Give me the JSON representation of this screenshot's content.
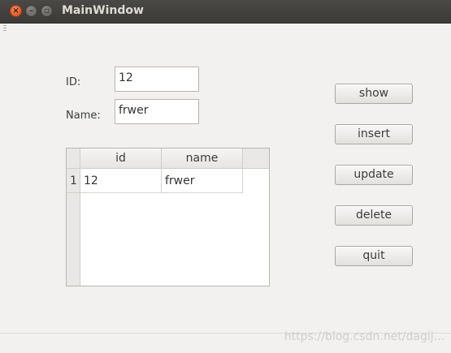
{
  "window": {
    "title": "MainWindow"
  },
  "titlebar": {
    "close_glyph": "×",
    "min_glyph": "–",
    "max_glyph": "▫"
  },
  "form": {
    "id_label": "ID:",
    "id_value": "12",
    "name_label": "Name:",
    "name_value": "frwer"
  },
  "table": {
    "headers": [
      "id",
      "name"
    ],
    "rows": [
      {
        "num": "1",
        "cells": [
          "12",
          "frwer"
        ]
      }
    ]
  },
  "buttons": {
    "show": "show",
    "insert": "insert",
    "update": "update",
    "delete": "delete",
    "quit": "quit"
  },
  "watermark": "https://blog.csdn.net/dagij..."
}
